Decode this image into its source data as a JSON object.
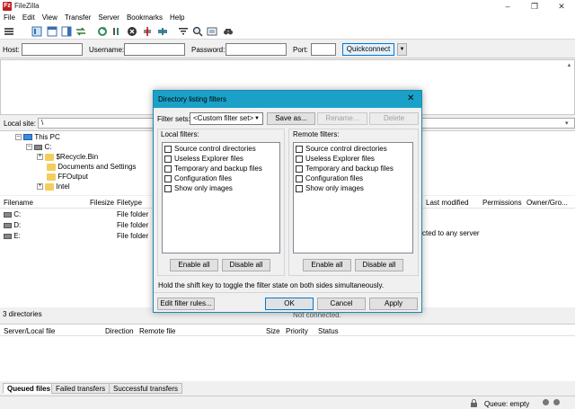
{
  "app": {
    "title": "FileZilla",
    "logo": "Fz"
  },
  "window_controls": [
    "–",
    "❐",
    "✕"
  ],
  "menu": [
    "File",
    "Edit",
    "View",
    "Transfer",
    "Server",
    "Bookmarks",
    "Help"
  ],
  "quickconnect": {
    "host_label": "Host:",
    "username_label": "Username:",
    "password_label": "Password:",
    "port_label": "Port:",
    "button_label": "Quickconnect",
    "dropdown_glyph": "▼"
  },
  "local": {
    "site_label": "Local site:",
    "path": "\\",
    "tree": [
      {
        "label": "This PC",
        "level": 0,
        "icon": "pc",
        "expander": "–"
      },
      {
        "label": "C:",
        "level": 1,
        "icon": "drive",
        "expander": "–"
      },
      {
        "label": "$Recycle.Bin",
        "level": 2,
        "icon": "folder",
        "expander": "+"
      },
      {
        "label": "Documents and Settings",
        "level": 2,
        "icon": "folder",
        "expander": ""
      },
      {
        "label": "FFOutput",
        "level": 2,
        "icon": "folder",
        "expander": ""
      },
      {
        "label": "Intel",
        "level": 2,
        "icon": "folder",
        "expander": "+"
      }
    ],
    "columns": [
      "Filename",
      "Filesize",
      "Filetype"
    ],
    "rows": [
      {
        "name": "C:",
        "type": "File folder"
      },
      {
        "name": "D:",
        "type": "File folder"
      },
      {
        "name": "E:",
        "type": "File folder"
      }
    ],
    "status": "3 directories"
  },
  "remote": {
    "columns": [
      "Last modified",
      "Permissions",
      "Owner/Gro..."
    ],
    "message": "cted to any server",
    "status": "Not connected."
  },
  "queue": {
    "columns": [
      "Server/Local file",
      "Direction",
      "Remote file",
      "Size",
      "Priority",
      "Status"
    ],
    "tabs": [
      "Queued files",
      "Failed transfers",
      "Successful transfers"
    ],
    "status": "Queue: empty"
  },
  "dialog": {
    "title": "Directory listing filters",
    "close_glyph": "✕",
    "filter_sets_label": "Filter sets:",
    "filter_set_value": "<Custom filter set>",
    "save_as": "Save as...",
    "rename": "Rename...",
    "delete": "Delete",
    "local_filters_label": "Local filters:",
    "remote_filters_label": "Remote filters:",
    "filters": [
      "Source control directories",
      "Useless Explorer files",
      "Temporary and backup files",
      "Configuration files",
      "Show only images"
    ],
    "enable_all": "Enable all",
    "disable_all": "Disable all",
    "hint": "Hold the shift key to toggle the filter state on both sides simultaneously.",
    "edit_rules": "Edit filter rules...",
    "ok": "OK",
    "cancel": "Cancel",
    "apply": "Apply"
  },
  "colors": {
    "dialog_title": "#1ba1c8",
    "accent": "#0078d7",
    "folder": "#f4cd5c",
    "logo": "#bf1e1e"
  }
}
